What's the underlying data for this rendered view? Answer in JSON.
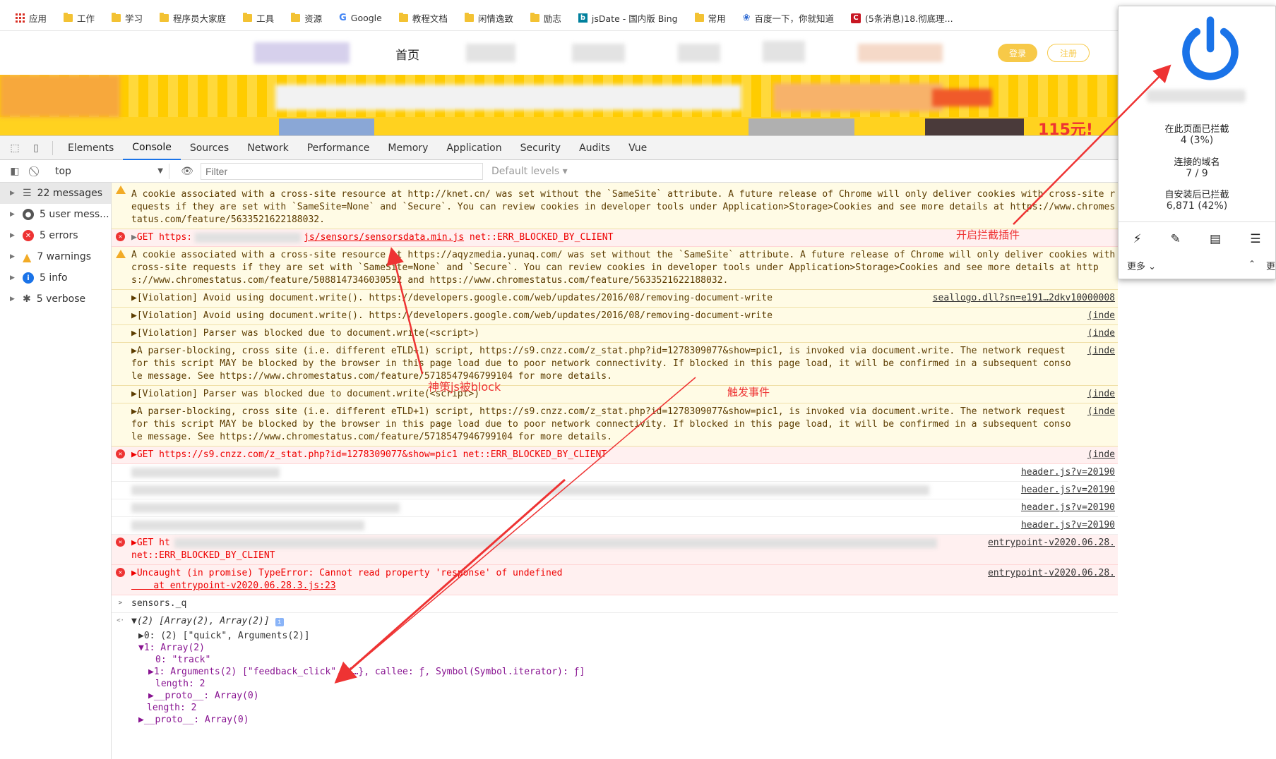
{
  "bookmarks": [
    {
      "label": "应用",
      "icon": "apps-grid-icon"
    },
    {
      "label": "工作",
      "icon": "folder-icon"
    },
    {
      "label": "学习",
      "icon": "folder-icon"
    },
    {
      "label": "程序员大家庭",
      "icon": "folder-icon"
    },
    {
      "label": "工具",
      "icon": "folder-icon"
    },
    {
      "label": "资源",
      "icon": "folder-icon"
    },
    {
      "label": "Google",
      "icon": "google-icon"
    },
    {
      "label": "教程文档",
      "icon": "folder-icon"
    },
    {
      "label": "闲情逸致",
      "icon": "folder-icon"
    },
    {
      "label": "励志",
      "icon": "folder-icon"
    },
    {
      "label": "jsDate - 国内版 Bing",
      "icon": "bing-icon"
    },
    {
      "label": "常用",
      "icon": "folder-icon"
    },
    {
      "label": "百度一下，你就知道",
      "icon": "baidu-paw-icon"
    },
    {
      "label": "(5条消息)18.彻底理...",
      "icon": "csdn-icon"
    }
  ],
  "site": {
    "home": "首页",
    "login": "登录",
    "register": "注册",
    "banner_badge": "115元!"
  },
  "devtools": {
    "tabs": [
      "Elements",
      "Console",
      "Sources",
      "Network",
      "Performance",
      "Memory",
      "Application",
      "Security",
      "Audits",
      "Vue"
    ],
    "active_tab": "Console",
    "context": "top",
    "filter_placeholder": "Filter",
    "levels": "Default levels ▾",
    "sidebar": [
      {
        "label": "22 messages",
        "icon": "list-icon",
        "color": "#555555"
      },
      {
        "label": "5 user mess...",
        "icon": "user-icon",
        "color": "#555555"
      },
      {
        "label": "5 errors",
        "icon": "error-icon",
        "color": "#e33333"
      },
      {
        "label": "7 warnings",
        "icon": "warning-icon",
        "color": "#f2ab26"
      },
      {
        "label": "5 info",
        "icon": "info-icon",
        "color": "#1a73e8"
      },
      {
        "label": "5 verbose",
        "icon": "bug-icon",
        "color": "#555555"
      }
    ]
  },
  "console": {
    "warn1": "A cookie associated with a cross-site resource at http://knet.cn/ was set without the `SameSite` attribute. A future release of Chrome will only deliver cookies with cross-site requests if they are set with `SameSite=None` and `Secure`. You can review cookies in developer tools under Application>Storage>Cookies and see more details at https://www.chromestatus.com/feature/5633521622188032.",
    "err1_pre": "GET https:",
    "err1_link": "js/sensors/sensorsdata.min.js",
    "err1_post": " net::ERR_BLOCKED_BY_CLIENT",
    "warn2": "A cookie associated with a cross-site resource at https://aqyzmedia.yunaq.com/ was set without the `SameSite` attribute. A future release of Chrome will only deliver cookies with cross-site requests if they are set with `SameSite=None` and `Secure`. You can review cookies in developer tools under Application>Storage>Cookies and see more details at https://www.chromestatus.com/feature/5088147346030592 and https://www.chromestatus.com/feature/5633521622188032.",
    "viol1": "▶[Violation] Avoid using document.write(). https://developers.google.com/web/updates/2016/08/removing-document-write",
    "viol1_src": "seallogo.dll?sn=e191…2dkv10000008",
    "viol2": "▶[Violation] Avoid using document.write(). https://developers.google.com/web/updates/2016/08/removing-document-write",
    "viol3": "▶[Violation] Parser was blocked due to document.write(<script>)",
    "parser1": "▶A parser-blocking, cross site (i.e. different eTLD+1) script, https://s9.cnzz.com/z_stat.php?id=1278309077&show=pic1, is invoked via document.write. The network request for this script MAY be blocked by the browser in this page load due to poor network connectivity. If blocked in this page load, it will be confirmed in a subsequent console message. See https://www.chromestatus.com/feature/5718547946799104 for more details.",
    "viol4": "▶[Violation] Parser was blocked due to document.write(<script>)",
    "parser2": "▶A parser-blocking, cross site (i.e. different eTLD+1) script, https://s9.cnzz.com/z_stat.php?id=1278309077&show=pic1, is invoked via document.write. The network request for this script MAY be blocked by the browser in this page load due to poor network connectivity. If blocked in this page load, it will be confirmed in a subsequent console message. See https://www.chromestatus.com/feature/5718547946799104 for more details.",
    "err2": "▶GET https://s9.cnzz.com/z_stat.php?id=1278309077&show=pic1 net::ERR_BLOCKED_BY_CLIENT",
    "src_inde": "(inde",
    "src_header": "header.js?v=20190",
    "err3_pre": "▶GET ht",
    "err3_post": "net::ERR_BLOCKED_BY_CLIENT",
    "src_entry": "entrypoint-v2020.06.28.",
    "err4": "▶Uncaught (in promise) TypeError: Cannot read property 'response' of undefined",
    "err4_at": "    at entrypoint-v2020.06.28.3.js:23",
    "prompt_input": "sensors._q",
    "result_head": "▼(2) [Array(2), Array(2)]",
    "r0": "▶0: (2) [\"quick\", Arguments(2)]",
    "r1": "▼1: Array(2)",
    "r1_0": "0: \"track\"",
    "r1_1": "▶1: Arguments(2) [\"feedback_click\", {…}, callee: ƒ, Symbol(Symbol.iterator): ƒ]",
    "r1_len": "length: 2",
    "r1_proto": "▶__proto__: Array(0)",
    "len": "length: 2",
    "proto": "▶__proto__: Array(0)"
  },
  "popup": {
    "stat1_label": "在此页面已拦截",
    "stat1_value": "4 (3%)",
    "stat2_label": "连接的域名",
    "stat2_value": "7 / 9",
    "stat3_label": "自安装后已拦截",
    "stat3_value": "6,871 (42%)",
    "tools": [
      {
        "icon": "lightning-icon",
        "glyph": "⚡"
      },
      {
        "icon": "eyedropper-icon",
        "glyph": "✎"
      },
      {
        "icon": "list-view-icon",
        "glyph": "▤"
      },
      {
        "icon": "sliders-icon",
        "glyph": "☰"
      }
    ],
    "more": "更多",
    "more2": "更",
    "power_color": "#1a73e8"
  },
  "annotations": {
    "plugin": "开启拦截插件",
    "blocked": "神策js被block",
    "trigger": "触发事件",
    "color": "#e33333"
  }
}
